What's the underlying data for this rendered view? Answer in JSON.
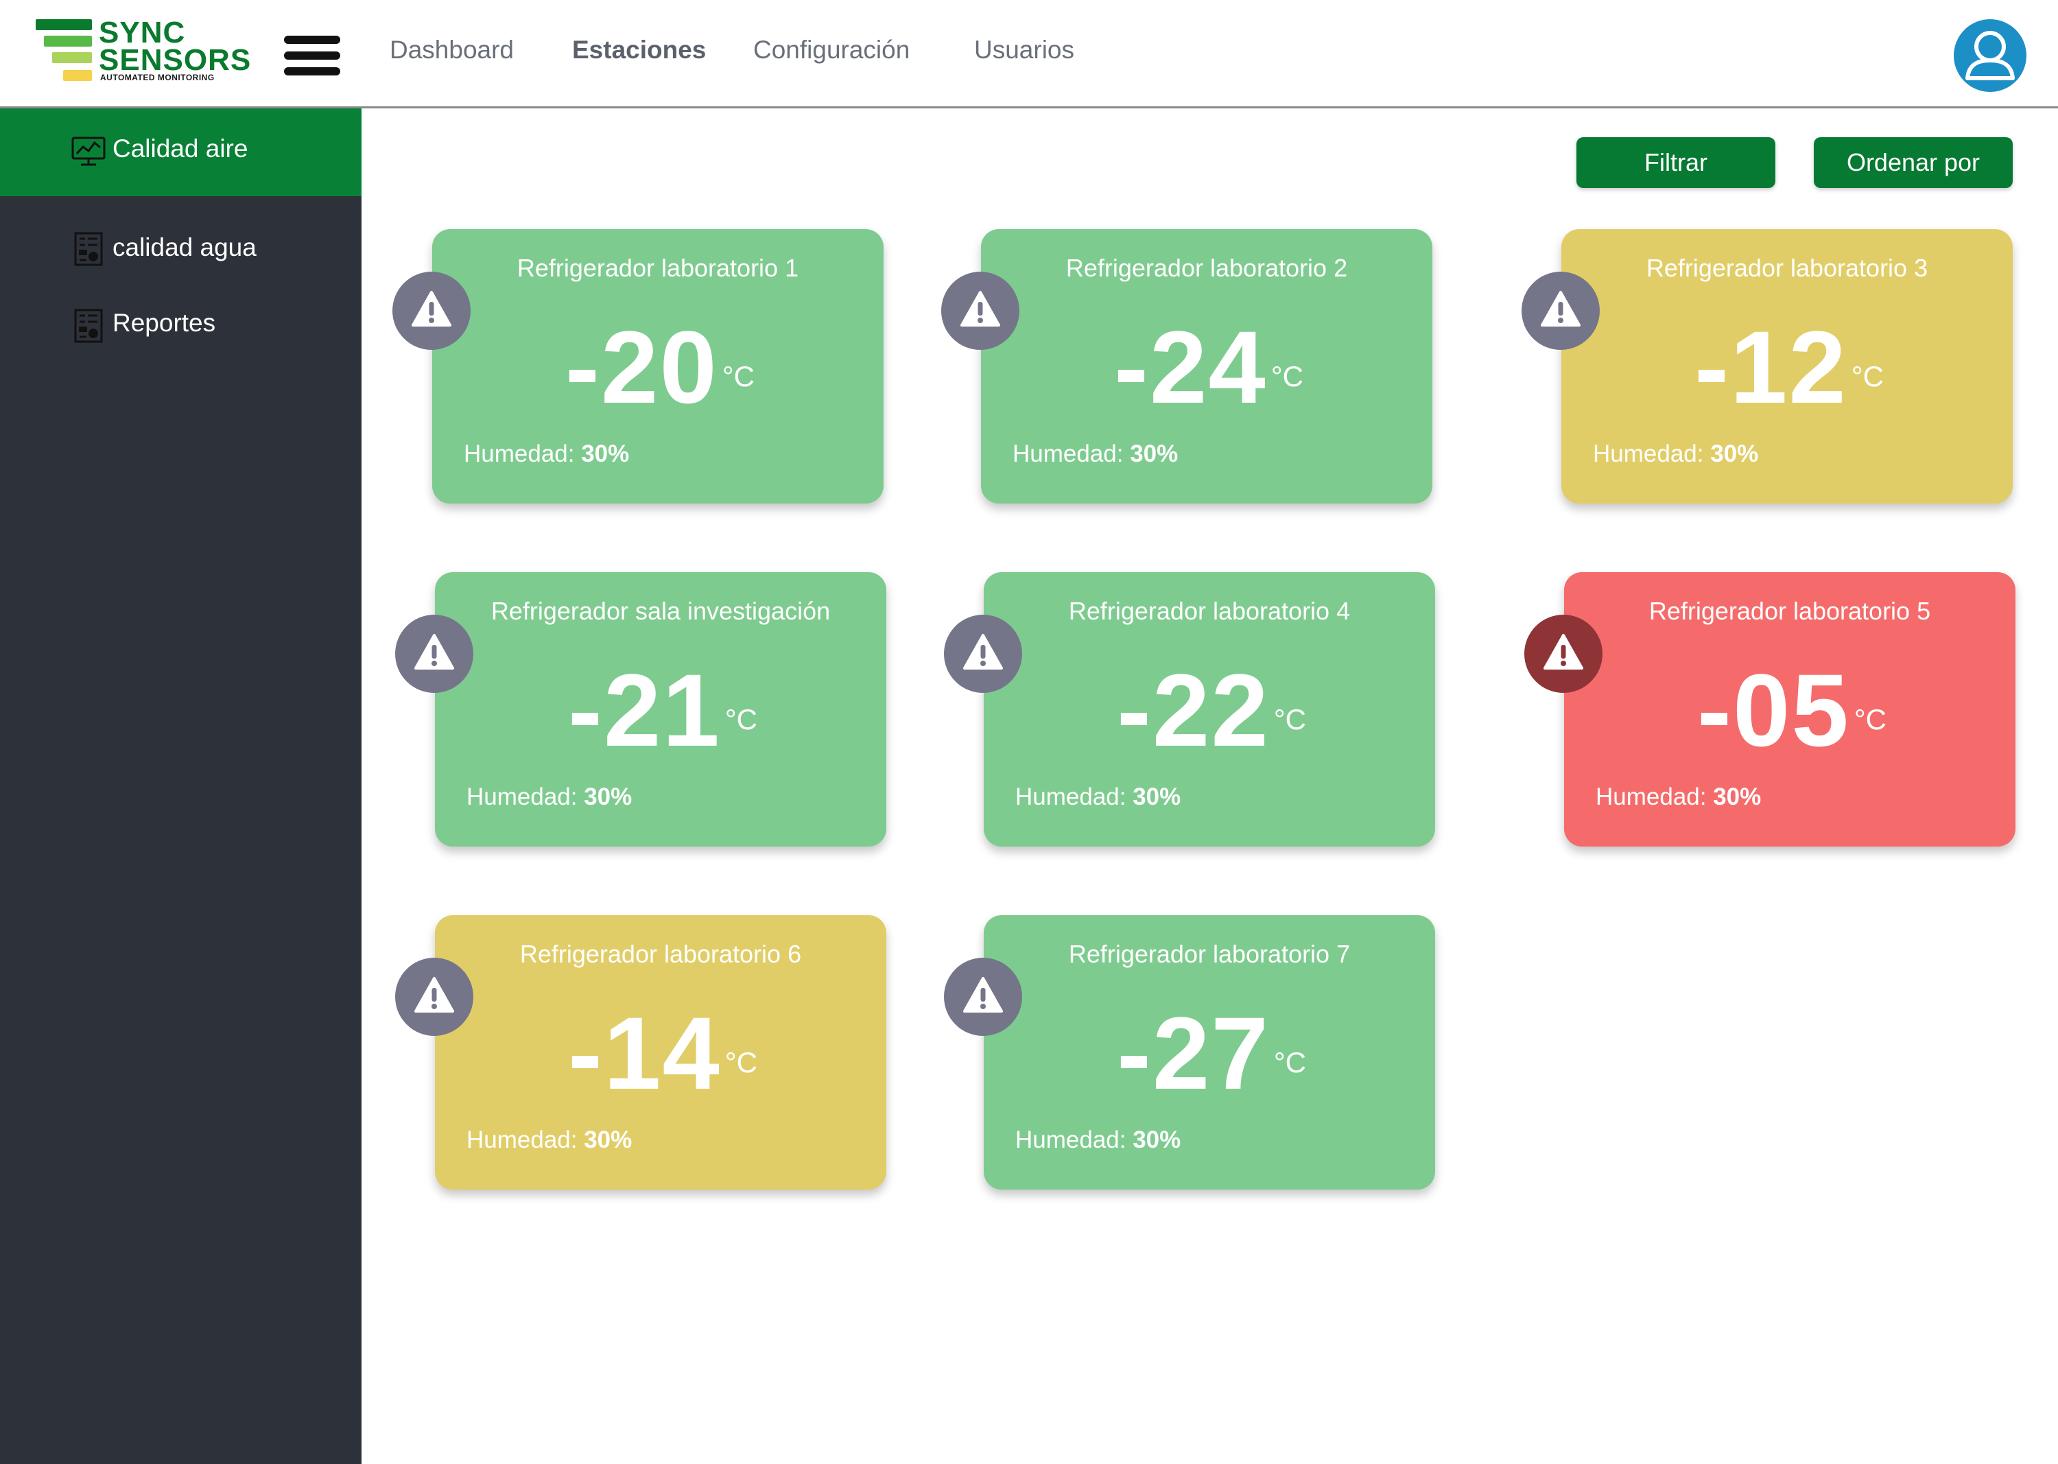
{
  "brand": {
    "line1": "SYNC",
    "line2": "SENSORS",
    "tagline": "AUTOMATED MONITORING"
  },
  "nav": [
    {
      "label": "Dashboard",
      "active": false
    },
    {
      "label": "Estaciones",
      "active": true
    },
    {
      "label": "Configuración",
      "active": false
    },
    {
      "label": "Usuarios",
      "active": false
    }
  ],
  "sidebar": {
    "items": [
      {
        "label": "Calidad aire",
        "icon": "monitor-chart-icon",
        "active": true
      },
      {
        "label": "calidad agua",
        "icon": "report-icon",
        "active": false
      },
      {
        "label": "Reportes",
        "icon": "report-icon",
        "active": false
      }
    ]
  },
  "toolbar": {
    "filter_label": "Filtrar",
    "sort_label": "Ordenar por"
  },
  "colors": {
    "ok": "#7ecb8f",
    "warning": "#e1cd67",
    "danger": "#f56b6b",
    "alert_badge": "#75758a",
    "alert_badge_danger": "#8e3437",
    "primary": "#067a32",
    "sidebar_bg": "#2d3139"
  },
  "stations": [
    {
      "name": "Refrigerador laboratorio 1",
      "temp": "-20",
      "unit": "°C",
      "humidity_label": "Humedad:",
      "humidity": "30%",
      "status": "ok"
    },
    {
      "name": "Refrigerador laboratorio 2",
      "temp": "-24",
      "unit": "°C",
      "humidity_label": "Humedad:",
      "humidity": "30%",
      "status": "ok"
    },
    {
      "name": "Refrigerador laboratorio 3",
      "temp": "-12",
      "unit": "°C",
      "humidity_label": "Humedad:",
      "humidity": "30%",
      "status": "warning"
    },
    {
      "name": "Refrigerador sala investigación",
      "temp": "-21",
      "unit": "°C",
      "humidity_label": "Humedad:",
      "humidity": "30%",
      "status": "ok"
    },
    {
      "name": "Refrigerador laboratorio 4",
      "temp": "-22",
      "unit": "°C",
      "humidity_label": "Humedad:",
      "humidity": "30%",
      "status": "ok"
    },
    {
      "name": "Refrigerador laboratorio 5",
      "temp": "-05",
      "unit": "°C",
      "humidity_label": "Humedad:",
      "humidity": "30%",
      "status": "danger"
    },
    {
      "name": "Refrigerador laboratorio 6",
      "temp": "-14",
      "unit": "°C",
      "humidity_label": "Humedad:",
      "humidity": "30%",
      "status": "warning"
    },
    {
      "name": "Refrigerador laboratorio 7",
      "temp": "-27",
      "unit": "°C",
      "humidity_label": "Humedad:",
      "humidity": "30%",
      "status": "ok"
    }
  ]
}
